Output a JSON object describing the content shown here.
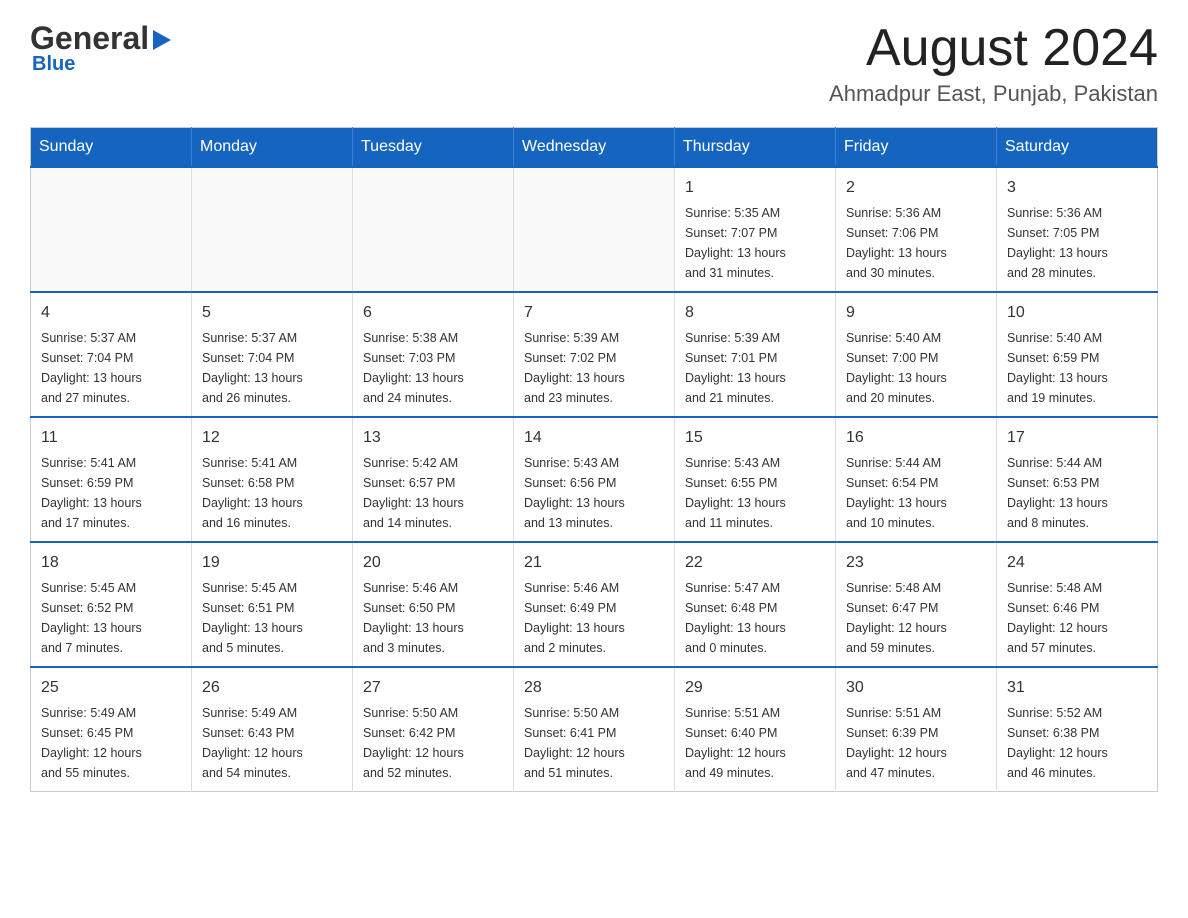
{
  "header": {
    "logo_general": "General",
    "logo_blue": "Blue",
    "month_title": "August 2024",
    "location": "Ahmadpur East, Punjab, Pakistan"
  },
  "days_of_week": [
    "Sunday",
    "Monday",
    "Tuesday",
    "Wednesday",
    "Thursday",
    "Friday",
    "Saturday"
  ],
  "weeks": [
    [
      {
        "day": "",
        "info": ""
      },
      {
        "day": "",
        "info": ""
      },
      {
        "day": "",
        "info": ""
      },
      {
        "day": "",
        "info": ""
      },
      {
        "day": "1",
        "info": "Sunrise: 5:35 AM\nSunset: 7:07 PM\nDaylight: 13 hours\nand 31 minutes."
      },
      {
        "day": "2",
        "info": "Sunrise: 5:36 AM\nSunset: 7:06 PM\nDaylight: 13 hours\nand 30 minutes."
      },
      {
        "day": "3",
        "info": "Sunrise: 5:36 AM\nSunset: 7:05 PM\nDaylight: 13 hours\nand 28 minutes."
      }
    ],
    [
      {
        "day": "4",
        "info": "Sunrise: 5:37 AM\nSunset: 7:04 PM\nDaylight: 13 hours\nand 27 minutes."
      },
      {
        "day": "5",
        "info": "Sunrise: 5:37 AM\nSunset: 7:04 PM\nDaylight: 13 hours\nand 26 minutes."
      },
      {
        "day": "6",
        "info": "Sunrise: 5:38 AM\nSunset: 7:03 PM\nDaylight: 13 hours\nand 24 minutes."
      },
      {
        "day": "7",
        "info": "Sunrise: 5:39 AM\nSunset: 7:02 PM\nDaylight: 13 hours\nand 23 minutes."
      },
      {
        "day": "8",
        "info": "Sunrise: 5:39 AM\nSunset: 7:01 PM\nDaylight: 13 hours\nand 21 minutes."
      },
      {
        "day": "9",
        "info": "Sunrise: 5:40 AM\nSunset: 7:00 PM\nDaylight: 13 hours\nand 20 minutes."
      },
      {
        "day": "10",
        "info": "Sunrise: 5:40 AM\nSunset: 6:59 PM\nDaylight: 13 hours\nand 19 minutes."
      }
    ],
    [
      {
        "day": "11",
        "info": "Sunrise: 5:41 AM\nSunset: 6:59 PM\nDaylight: 13 hours\nand 17 minutes."
      },
      {
        "day": "12",
        "info": "Sunrise: 5:41 AM\nSunset: 6:58 PM\nDaylight: 13 hours\nand 16 minutes."
      },
      {
        "day": "13",
        "info": "Sunrise: 5:42 AM\nSunset: 6:57 PM\nDaylight: 13 hours\nand 14 minutes."
      },
      {
        "day": "14",
        "info": "Sunrise: 5:43 AM\nSunset: 6:56 PM\nDaylight: 13 hours\nand 13 minutes."
      },
      {
        "day": "15",
        "info": "Sunrise: 5:43 AM\nSunset: 6:55 PM\nDaylight: 13 hours\nand 11 minutes."
      },
      {
        "day": "16",
        "info": "Sunrise: 5:44 AM\nSunset: 6:54 PM\nDaylight: 13 hours\nand 10 minutes."
      },
      {
        "day": "17",
        "info": "Sunrise: 5:44 AM\nSunset: 6:53 PM\nDaylight: 13 hours\nand 8 minutes."
      }
    ],
    [
      {
        "day": "18",
        "info": "Sunrise: 5:45 AM\nSunset: 6:52 PM\nDaylight: 13 hours\nand 7 minutes."
      },
      {
        "day": "19",
        "info": "Sunrise: 5:45 AM\nSunset: 6:51 PM\nDaylight: 13 hours\nand 5 minutes."
      },
      {
        "day": "20",
        "info": "Sunrise: 5:46 AM\nSunset: 6:50 PM\nDaylight: 13 hours\nand 3 minutes."
      },
      {
        "day": "21",
        "info": "Sunrise: 5:46 AM\nSunset: 6:49 PM\nDaylight: 13 hours\nand 2 minutes."
      },
      {
        "day": "22",
        "info": "Sunrise: 5:47 AM\nSunset: 6:48 PM\nDaylight: 13 hours\nand 0 minutes."
      },
      {
        "day": "23",
        "info": "Sunrise: 5:48 AM\nSunset: 6:47 PM\nDaylight: 12 hours\nand 59 minutes."
      },
      {
        "day": "24",
        "info": "Sunrise: 5:48 AM\nSunset: 6:46 PM\nDaylight: 12 hours\nand 57 minutes."
      }
    ],
    [
      {
        "day": "25",
        "info": "Sunrise: 5:49 AM\nSunset: 6:45 PM\nDaylight: 12 hours\nand 55 minutes."
      },
      {
        "day": "26",
        "info": "Sunrise: 5:49 AM\nSunset: 6:43 PM\nDaylight: 12 hours\nand 54 minutes."
      },
      {
        "day": "27",
        "info": "Sunrise: 5:50 AM\nSunset: 6:42 PM\nDaylight: 12 hours\nand 52 minutes."
      },
      {
        "day": "28",
        "info": "Sunrise: 5:50 AM\nSunset: 6:41 PM\nDaylight: 12 hours\nand 51 minutes."
      },
      {
        "day": "29",
        "info": "Sunrise: 5:51 AM\nSunset: 6:40 PM\nDaylight: 12 hours\nand 49 minutes."
      },
      {
        "day": "30",
        "info": "Sunrise: 5:51 AM\nSunset: 6:39 PM\nDaylight: 12 hours\nand 47 minutes."
      },
      {
        "day": "31",
        "info": "Sunrise: 5:52 AM\nSunset: 6:38 PM\nDaylight: 12 hours\nand 46 minutes."
      }
    ]
  ]
}
